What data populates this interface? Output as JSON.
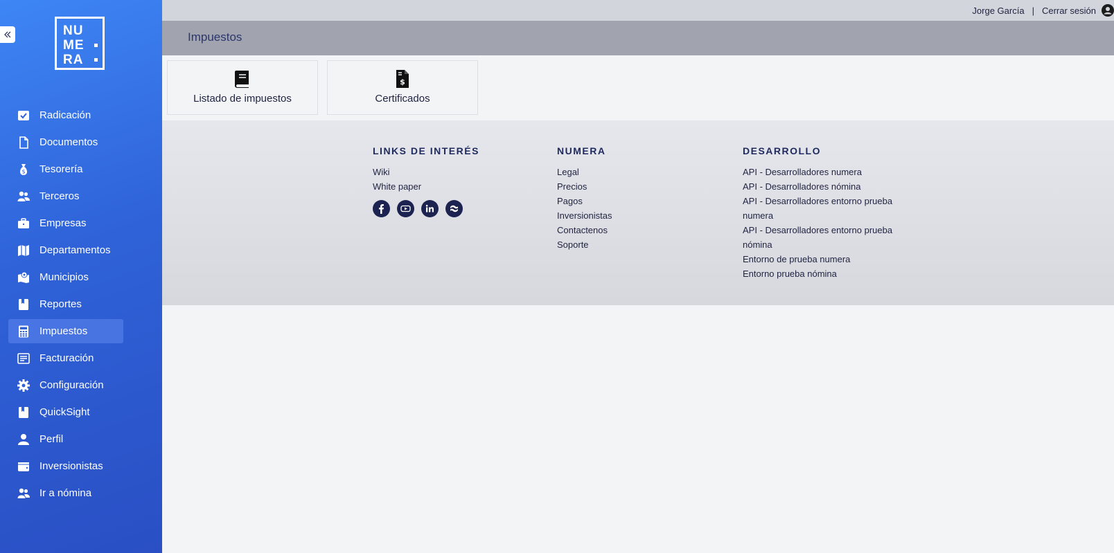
{
  "header": {
    "user_name": "Jorge García",
    "separator": "|",
    "logout": "Cerrar sesión",
    "page_title": "Impuestos"
  },
  "logo": {
    "rows": [
      "NU",
      "ME",
      "RA"
    ]
  },
  "sidebar": {
    "items": [
      {
        "label": "Radicación",
        "icon": "check-square-icon"
      },
      {
        "label": "Documentos",
        "icon": "document-icon"
      },
      {
        "label": "Tesorería",
        "icon": "money-bag-icon"
      },
      {
        "label": "Terceros",
        "icon": "users-icon"
      },
      {
        "label": "Empresas",
        "icon": "briefcase-icon"
      },
      {
        "label": "Departamentos",
        "icon": "map-icon"
      },
      {
        "label": "Municipios",
        "icon": "map-marked-icon"
      },
      {
        "label": "Reportes",
        "icon": "book-icon"
      },
      {
        "label": "Impuestos",
        "icon": "calculator-icon",
        "active": true
      },
      {
        "label": "Facturación",
        "icon": "invoice-icon"
      },
      {
        "label": "Configuración",
        "icon": "gear-icon"
      },
      {
        "label": "QuickSight",
        "icon": "book-icon"
      },
      {
        "label": "Perfil",
        "icon": "user-icon"
      },
      {
        "label": "Inversionistas",
        "icon": "wallet-icon"
      },
      {
        "label": "Ir a nómina",
        "icon": "users-icon"
      }
    ]
  },
  "cards": [
    {
      "label": "Listado de impuestos",
      "icon": "book-icon"
    },
    {
      "label": "Certificados",
      "icon": "file-invoice-dollar-icon"
    }
  ],
  "footer": {
    "links_title": "LINKS DE INTERÉS",
    "links": [
      "Wiki",
      "White paper"
    ],
    "socials": [
      "facebook-icon",
      "youtube-icon",
      "linkedin-icon",
      "confluence-icon"
    ],
    "numera_title": "NUMERA",
    "numera_links": [
      "Legal",
      "Precios",
      "Pagos",
      "Inversionistas",
      "Contactenos",
      "Soporte"
    ],
    "dev_title": "DESARROLLO",
    "dev_links": [
      "API - Desarrolladores numera",
      "API - Desarrolladores nómina",
      "API - Desarrolladores entorno prueba numera",
      "API - Desarrolladores entorno prueba nómina",
      "Entorno de prueba numera",
      "Entorno prueba nómina"
    ]
  },
  "colors": {
    "sidebar_top": "#3e86f5",
    "sidebar_bottom": "#2a4fc4",
    "header_band": "#a1a4af",
    "navy": "#1f2a5e"
  }
}
